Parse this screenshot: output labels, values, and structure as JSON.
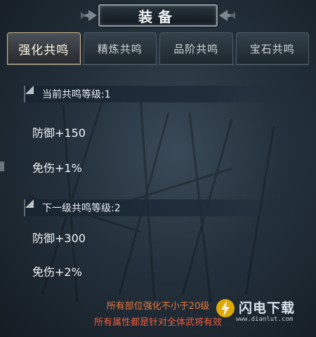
{
  "title": "装备",
  "tabs": [
    {
      "label": "强化共鸣",
      "active": true
    },
    {
      "label": "精炼共鸣",
      "active": false
    },
    {
      "label": "品阶共鸣",
      "active": false
    },
    {
      "label": "宝石共鸣",
      "active": false
    }
  ],
  "current": {
    "header": "当前共鸣等级:1",
    "stats": [
      "防御+150",
      "免伤+1%"
    ]
  },
  "next": {
    "header": "下一级共鸣等级:2",
    "stats": [
      "防御+300",
      "免伤+2%"
    ]
  },
  "footer": {
    "line1": "所有部位强化不小于20级",
    "line2": "所有属性都是针对全体武将有效"
  },
  "watermark": {
    "text": "闪电下载",
    "url": "www.dianlut.com"
  },
  "colors": {
    "accent_gold": "#c9b58c",
    "footer_orange": "#e8773a",
    "footer_red": "#f25a3e"
  }
}
